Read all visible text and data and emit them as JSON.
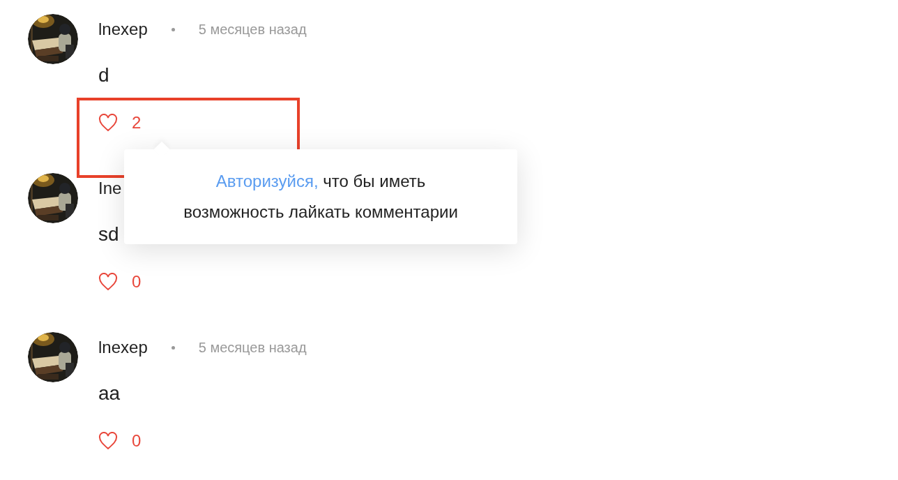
{
  "comments": [
    {
      "author": "lnexep",
      "time": "5 месяцев назад",
      "text": "d",
      "likes": "2",
      "highlighted": true
    },
    {
      "author": "Ine",
      "text": "sd",
      "likes": "0",
      "highlighted": false
    },
    {
      "author": "lnexep",
      "time": "5 месяцев назад",
      "text": "aa",
      "likes": "0",
      "highlighted": false
    }
  ],
  "tooltip": {
    "link": "Авторизуйся,",
    "lines": [
      "что бы иметь",
      "возможность лайкать комментарии"
    ]
  }
}
